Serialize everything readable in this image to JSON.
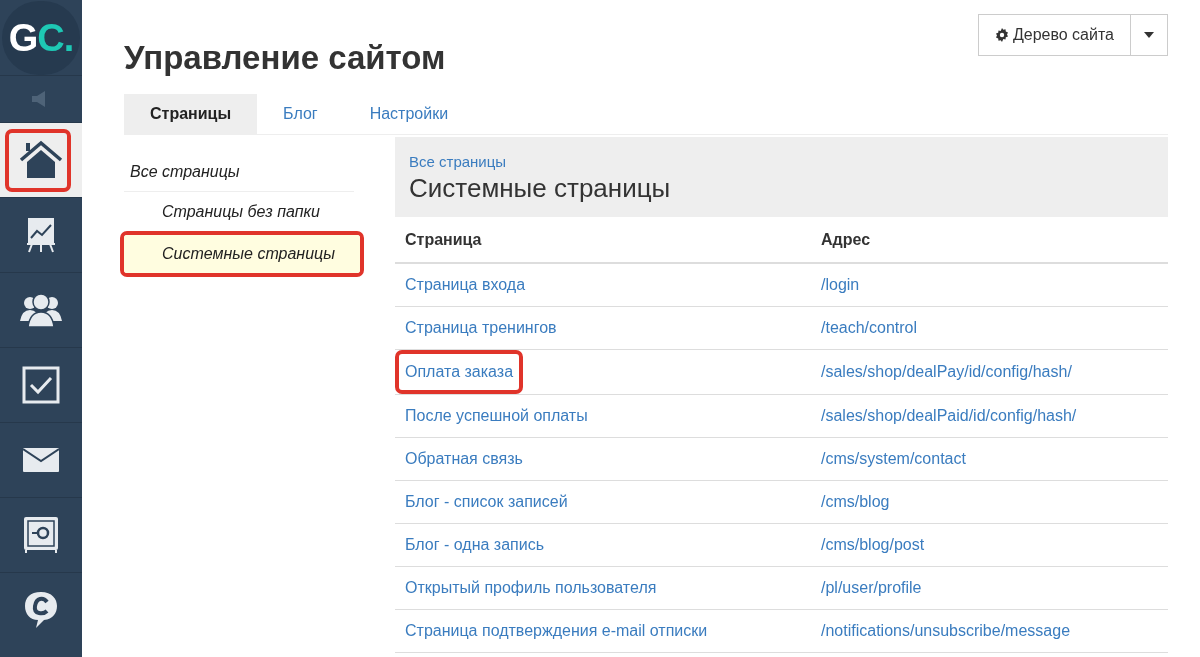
{
  "sidebar": {
    "items": [
      {
        "kind": "speaker",
        "selected": false,
        "highlighted": false
      },
      {
        "kind": "home",
        "selected": true,
        "highlighted": true
      },
      {
        "kind": "chart",
        "selected": false,
        "highlighted": false
      },
      {
        "kind": "users",
        "selected": false,
        "highlighted": false
      },
      {
        "kind": "tasks",
        "selected": false,
        "highlighted": false
      },
      {
        "kind": "mail",
        "selected": false,
        "highlighted": false
      },
      {
        "kind": "safe",
        "selected": false,
        "highlighted": false
      },
      {
        "kind": "chat",
        "selected": false,
        "highlighted": false
      }
    ]
  },
  "logo": {
    "letter_1": "G",
    "letter_2": "C."
  },
  "title": "Управление сайтом",
  "site_tree_button": "Дерево сайта",
  "tabs": [
    {
      "label": "Страницы",
      "selected": true
    },
    {
      "label": "Блог",
      "selected": false
    },
    {
      "label": "Настройки",
      "selected": false
    }
  ],
  "folders": [
    {
      "label": "Все страницы",
      "selected": false,
      "highlighted": false,
      "children": [
        {
          "label": "Страницы без папки",
          "selected": false,
          "highlighted": false
        },
        {
          "label": "Системные страницы",
          "selected": true,
          "highlighted": true
        }
      ]
    }
  ],
  "panel": {
    "breadcrumb": "Все страницы",
    "heading": "Системные страницы"
  },
  "table": {
    "columns": [
      "Страница",
      "Адрес"
    ],
    "rows": [
      {
        "page": "Страница входа",
        "address": "/login",
        "highlighted": false
      },
      {
        "page": "Страница тренингов",
        "address": "/teach/control",
        "highlighted": false
      },
      {
        "page": "Оплата заказа",
        "address": "/sales/shop/dealPay/id/config/hash/",
        "highlighted": true
      },
      {
        "page": "После успешной оплаты",
        "address": "/sales/shop/dealPaid/id/config/hash/",
        "highlighted": false
      },
      {
        "page": "Обратная связь",
        "address": "/cms/system/contact",
        "highlighted": false
      },
      {
        "page": "Блог - список записей",
        "address": "/cms/blog",
        "highlighted": false
      },
      {
        "page": "Блог - одна запись",
        "address": "/cms/blog/post",
        "highlighted": false
      },
      {
        "page": "Открытый профиль пользователя",
        "address": "/pl/user/profile",
        "highlighted": false
      },
      {
        "page": "Страница подтверждения e-mail отписки",
        "address": "/notifications/unsubscribe/message",
        "highlighted": false
      }
    ]
  }
}
